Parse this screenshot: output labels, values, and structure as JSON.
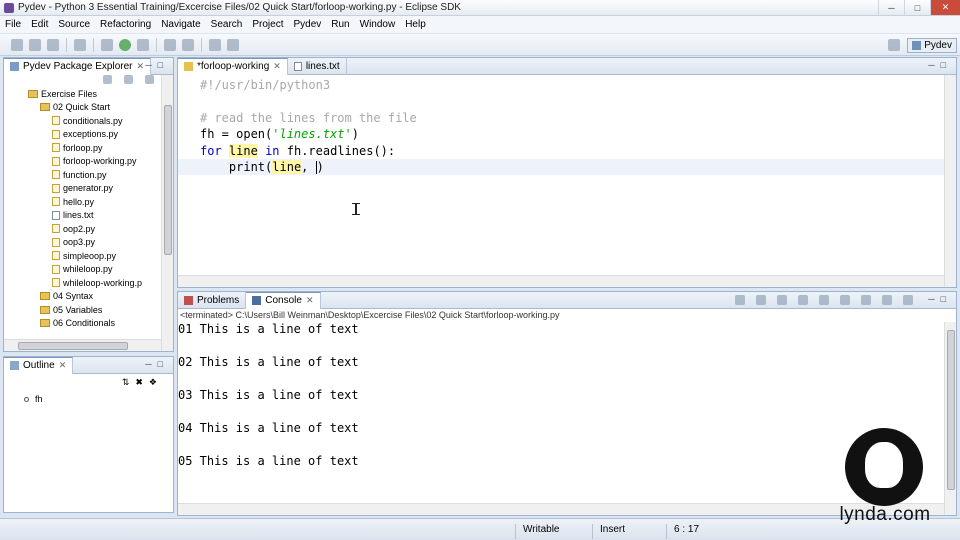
{
  "window": {
    "title": "Pydev - Python 3 Essential Training/Excercise Files/02 Quick Start/forloop-working.py - Eclipse SDK"
  },
  "menu": [
    "File",
    "Edit",
    "Source",
    "Refactoring",
    "Navigate",
    "Search",
    "Project",
    "Pydev",
    "Run",
    "Window",
    "Help"
  ],
  "perspective": {
    "label": "Pydev"
  },
  "package_explorer": {
    "title": "Pydev Package Explorer",
    "items": [
      {
        "label": "Exercise Files",
        "kind": "folder",
        "indent": 2
      },
      {
        "label": "02 Quick Start",
        "kind": "folder",
        "indent": 3
      },
      {
        "label": "conditionals.py",
        "kind": "py",
        "indent": 4
      },
      {
        "label": "exceptions.py",
        "kind": "py",
        "indent": 4
      },
      {
        "label": "forloop.py",
        "kind": "py",
        "indent": 4
      },
      {
        "label": "forloop-working.py",
        "kind": "py",
        "indent": 4
      },
      {
        "label": "function.py",
        "kind": "py",
        "indent": 4
      },
      {
        "label": "generator.py",
        "kind": "py",
        "indent": 4
      },
      {
        "label": "hello.py",
        "kind": "py",
        "indent": 4
      },
      {
        "label": "lines.txt",
        "kind": "txt",
        "indent": 4
      },
      {
        "label": "oop2.py",
        "kind": "py",
        "indent": 4
      },
      {
        "label": "oop3.py",
        "kind": "py",
        "indent": 4
      },
      {
        "label": "simpleoop.py",
        "kind": "py",
        "indent": 4
      },
      {
        "label": "whileloop.py",
        "kind": "py",
        "indent": 4
      },
      {
        "label": "whileloop-working.p",
        "kind": "py",
        "indent": 4
      },
      {
        "label": "04 Syntax",
        "kind": "folder",
        "indent": 3
      },
      {
        "label": "05 Variables",
        "kind": "folder",
        "indent": 3
      },
      {
        "label": "06 Conditionals",
        "kind": "folder",
        "indent": 3
      }
    ]
  },
  "outline": {
    "title": "Outline",
    "items": [
      "fh"
    ]
  },
  "editor": {
    "tabs": [
      {
        "label": "*forloop-working",
        "active": true
      },
      {
        "label": "lines.txt",
        "active": false
      }
    ],
    "lines": {
      "l1": "#!/usr/bin/python3",
      "l3": "# read the lines from the file",
      "l4_a": "fh = open(",
      "l4_str": "'lines.txt'",
      "l4_b": ")",
      "l5_for": "for",
      "l5_var": "line",
      "l5_in": "in",
      "l5_rest": "fh.readlines():",
      "l6_a": "print(",
      "l6_var": "line",
      "l6_b": ", "
    }
  },
  "bottom_panel": {
    "tabs": [
      {
        "label": "Problems",
        "active": false
      },
      {
        "label": "Console",
        "active": true
      }
    ],
    "path": "<terminated> C:\\Users\\Bill Weinman\\Desktop\\Excercise Files\\02 Quick Start\\forloop-working.py",
    "output": [
      "01 This is a line of text",
      "02 This is a line of text",
      "03 This is a line of text",
      "04 This is a line of text",
      "05 This is a line of text"
    ]
  },
  "status": {
    "writable": "Writable",
    "mode": "Insert",
    "position": "6 : 17"
  },
  "watermark": {
    "text": "lynda.com"
  }
}
